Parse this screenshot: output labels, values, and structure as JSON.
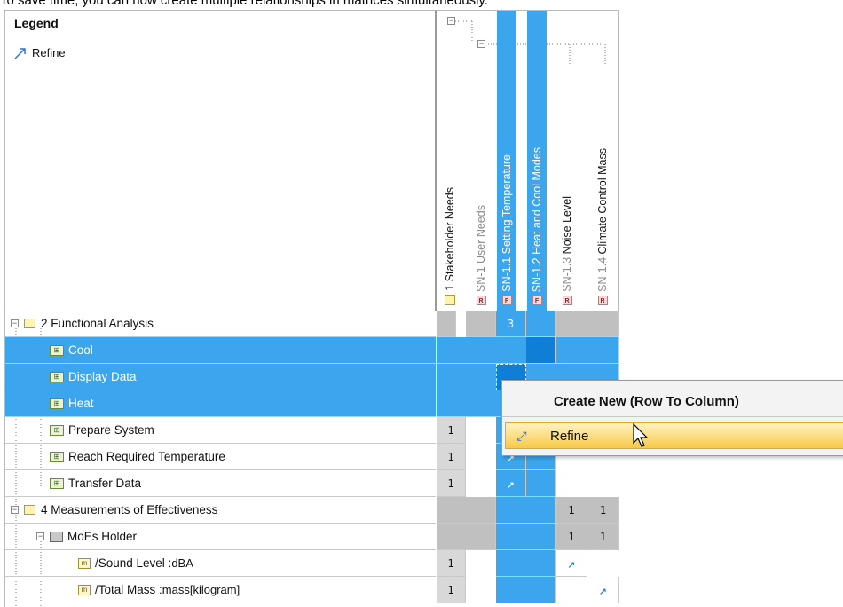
{
  "caption": "To save time, you can now create multiple relationships in matrices simultaneously.",
  "legend": {
    "title": "Legend",
    "item_label": "Refine",
    "item_icon": "refine-arrow-icon"
  },
  "columns": [
    {
      "label": "1 Stakeholder Needs",
      "badge": "",
      "muted": false,
      "selected": false
    },
    {
      "label": "SN-1 User Needs",
      "badge": "R",
      "muted": true,
      "selected": false
    },
    {
      "label": "SN-1.1 Setting Temperature",
      "badge": "F",
      "muted": false,
      "selected": true
    },
    {
      "label": "SN-1.2 Heat and Cool Modes",
      "badge": "F",
      "muted": false,
      "selected": true
    },
    {
      "label_prefix": "SN-1.3",
      "label": "Noise Level",
      "badge": "R",
      "muted": false,
      "selected": false
    },
    {
      "label_prefix": "SN-1.4",
      "label": "Climate Control Mass",
      "badge": "R",
      "muted": false,
      "selected": false
    }
  ],
  "rows": [
    {
      "label": "2 Functional Analysis",
      "selected": false
    },
    {
      "label": "Cool",
      "selected": true
    },
    {
      "label": "Display Data",
      "selected": true
    },
    {
      "label": "Heat",
      "selected": true
    },
    {
      "label": "Prepare System",
      "selected": false
    },
    {
      "label": "Reach Required Temperature",
      "selected": false
    },
    {
      "label": "Transfer Data",
      "selected": false
    },
    {
      "label": "4 Measurements of Effectiveness",
      "selected": false
    },
    {
      "label": "MoEs Holder",
      "selected": false
    },
    {
      "label": "/Sound Level : ",
      "type": "dBA",
      "selected": false
    },
    {
      "label": "/Total Mass : ",
      "type": "mass[kilogram]",
      "selected": false
    }
  ],
  "cells": {
    "functional_analysis_count": "3",
    "one": "1",
    "arrow": "↗"
  },
  "context_menu": {
    "title": "Create New (Row To Column)",
    "item_label": "Refine"
  },
  "colors": {
    "selection": "#3ba6ee",
    "selection_dark": "#0f7ed6",
    "group_gray": "#c0c0c0",
    "menu_highlight": "#f7c948"
  }
}
